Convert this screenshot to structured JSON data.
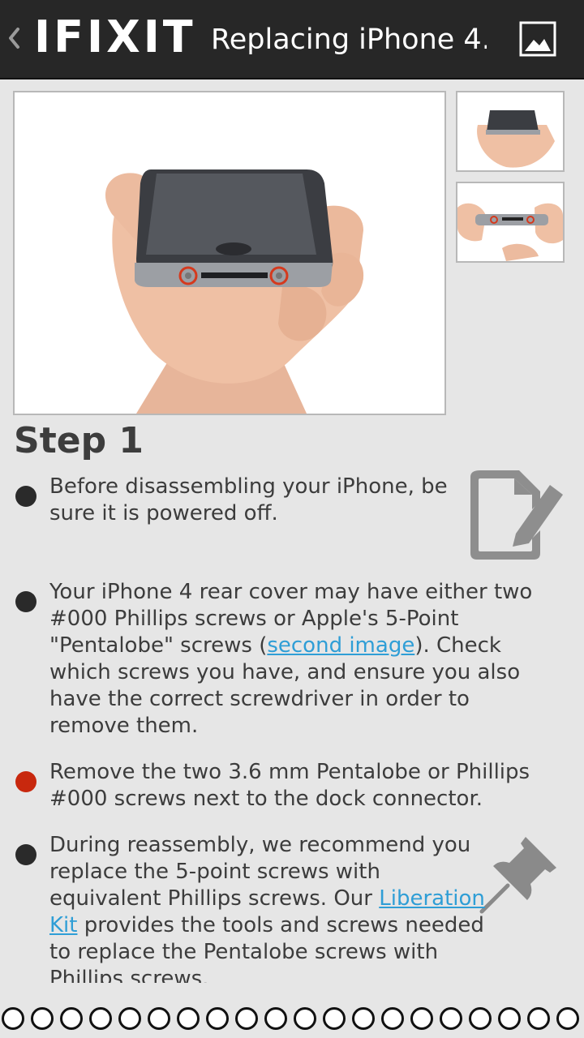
{
  "header": {
    "back_icon": "chevron-left-icon",
    "logo": "IFIXIT",
    "title": "Replacing iPhone 4...",
    "gallery_icon": "image-icon"
  },
  "images": {
    "main": "hand-holding-iphone-bottom-screws-highlighted",
    "thumbnails": [
      "hand-holding-iphone-bottom",
      "hand-holding-iphone-dock-screws"
    ]
  },
  "step": {
    "title": "Step 1",
    "bullets": [
      {
        "color": "black",
        "parts": [
          "Before disassembling your iPhone, be sure it is powered off."
        ]
      },
      {
        "color": "black",
        "parts": [
          "Your iPhone 4 rear cover may have either two #000 Phillips screws or Apple's 5-Point \"Pentalobe\" screws (",
          "second image",
          "). Check which screws you have, and ensure you also have the correct screwdriver in order to remove them."
        ]
      },
      {
        "color": "red",
        "parts": [
          "Remove the two 3.6 mm Pentalobe or Phillips #000 screws next to the dock connector."
        ]
      },
      {
        "color": "black",
        "parts": [
          "During reassembly, we recommend you replace the 5-point screws with equivalent Phillips screws. Our ",
          "Liberation Kit",
          " provides the tools and screws needed to replace the Pentalobe screws with Phillips screws."
        ]
      }
    ],
    "edit_icon": "edit-document-icon",
    "pin_icon": "pushpin-icon"
  },
  "pager": {
    "count": 20,
    "current": 1
  },
  "colors": {
    "header_bg": "#272727",
    "page_bg": "#e6e6e6",
    "link": "#2f9ed6",
    "bullet_black": "#2a2a2a",
    "bullet_red": "#c8280e"
  }
}
